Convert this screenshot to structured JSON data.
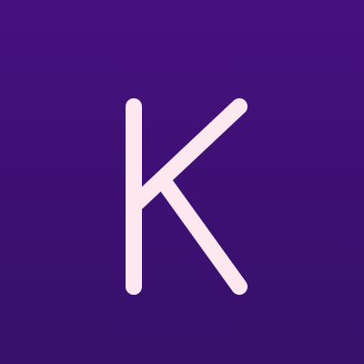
{
  "app_icon": {
    "monogram_letter": "K",
    "background_color_top": "#46117e",
    "background_color_bottom": "#36106b",
    "glyph_color": "#fde8ef"
  }
}
